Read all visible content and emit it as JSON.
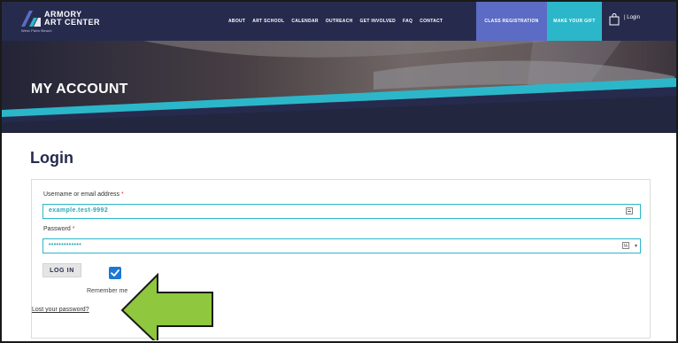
{
  "header": {
    "logo": {
      "line1": "ARMORY",
      "line2": "ART CENTER",
      "sub": "West Palm Beach"
    },
    "nav": [
      "ABOUT",
      "ART SCHOOL",
      "CALENDAR",
      "OUTREACH",
      "GET INVOLVED",
      "FAQ",
      "CONTACT"
    ],
    "cta_registration": "CLASS REGISTRATION",
    "cta_gift": "MAKE YOUR GIFT",
    "cart_icon": "shopping-bag-icon",
    "login_link": "| Login"
  },
  "hero": {
    "title": "MY ACCOUNT"
  },
  "login": {
    "heading": "Login",
    "username_label": "Username or email address",
    "username_value": "example.test-9992",
    "password_label": "Password",
    "password_value": "•••••••••••••",
    "required_mark": "*",
    "login_button": "LOG IN",
    "remember_label": "Remember me",
    "lost_password": "Lost your password?"
  },
  "colors": {
    "navy": "#262b4e",
    "accent_purple": "#5c6cc4",
    "accent_teal": "#2bb7c9",
    "checkbox_blue": "#1c78d6",
    "arrow_green": "#8fc73e"
  }
}
